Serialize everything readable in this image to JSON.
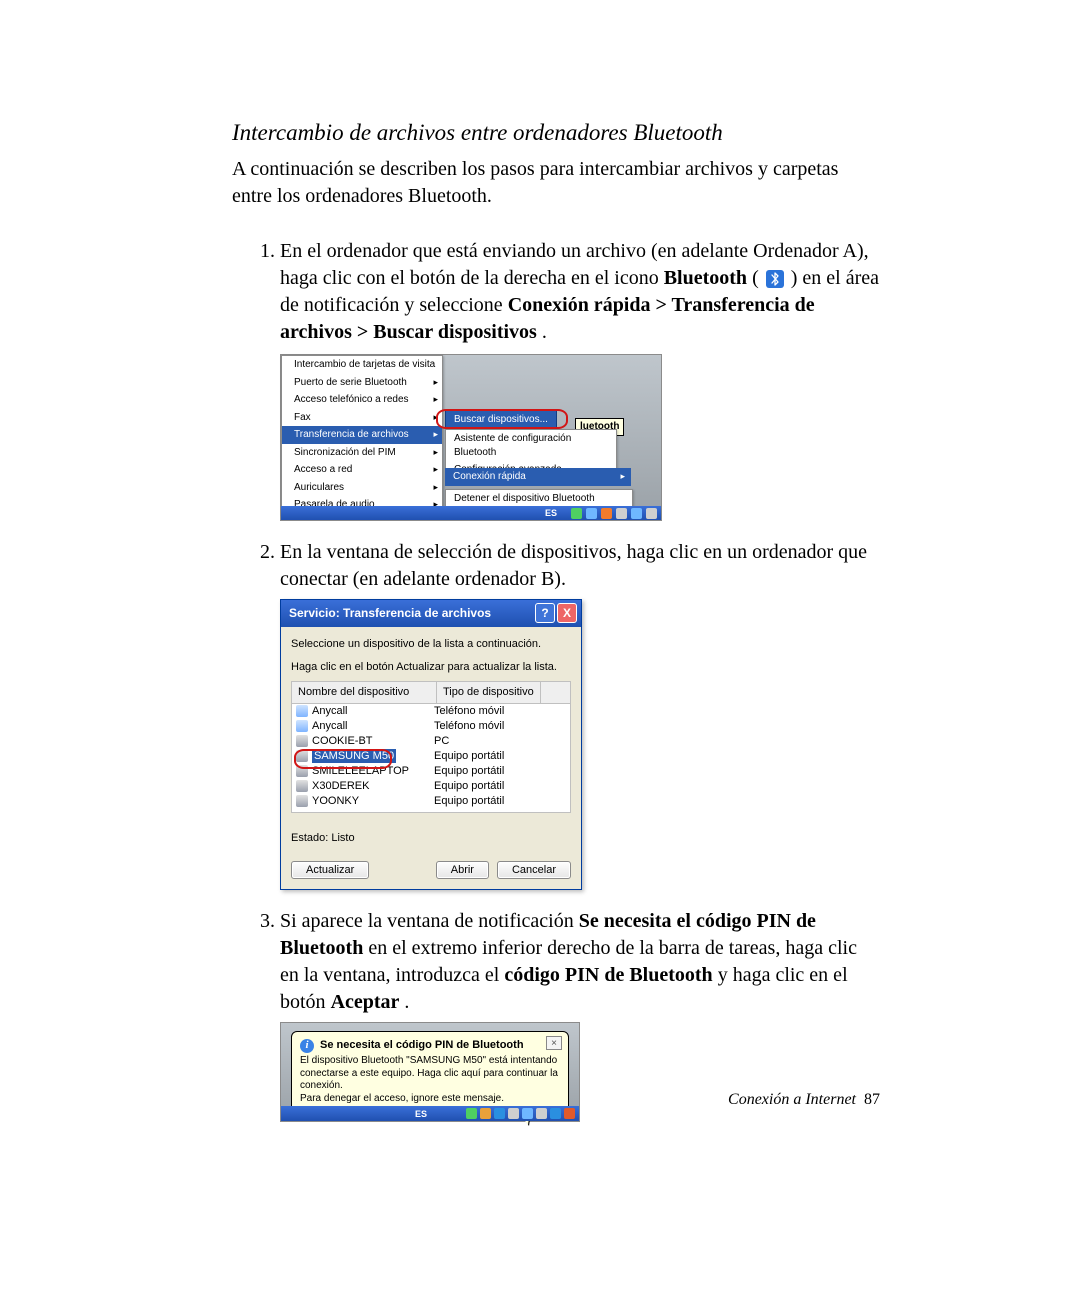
{
  "section_title": "Intercambio de archivos entre ordenadores Bluetooth",
  "intro": "A continuación se describen los pasos para intercambiar archivos y carpetas entre los ordenadores Bluetooth.",
  "step1": {
    "t1": "En el ordenador que está enviando un archivo (en adelante Ordenador A), haga clic con el botón de la derecha  en el icono ",
    "bt_word": "Bluetooth",
    "t2": " ( ",
    "t3": " ) en el área de notificación y seleccione ",
    "path_bold": "Conexión rápida > Transferencia de archivos > Buscar dispositivos",
    "t4": "."
  },
  "menu": {
    "items": [
      {
        "label": "Intercambio de tarjetas de visita",
        "arrow": false,
        "selected": false
      },
      {
        "label": "Puerto de serie Bluetooth",
        "arrow": true,
        "selected": false
      },
      {
        "label": "Acceso telefónico a redes",
        "arrow": true,
        "selected": false
      },
      {
        "label": "Fax",
        "arrow": true,
        "selected": false
      },
      {
        "label": "Transferencia de archivos",
        "arrow": true,
        "selected": true
      },
      {
        "label": "Sincronización del PIM",
        "arrow": true,
        "selected": false
      },
      {
        "label": "Acceso a red",
        "arrow": true,
        "selected": false
      },
      {
        "label": "Auriculares",
        "arrow": true,
        "selected": false
      },
      {
        "label": "Pasarela de audio",
        "arrow": true,
        "selected": false
      }
    ],
    "submenu_buscar": "Buscar dispositivos...",
    "tooltip_bt": "luetooth",
    "box_mid_1": "Asistente de configuración Bluetooth",
    "box_mid_2": "Configuración avanzada",
    "box_quick": "Conexión rápida",
    "box_stop": "Detener el dispositivo Bluetooth",
    "lang": "ES"
  },
  "step2": "En la ventana de selección de dispositivos, haga clic en un ordenador que conectar (en adelante ordenador B).",
  "dialog2": {
    "title": "Servicio: Transferencia de archivos",
    "instruct": "Seleccione un dispositivo de la lista a continuación.",
    "instruct2": "Haga clic en el botón Actualizar para actualizar la lista.",
    "col1": "Nombre del dispositivo",
    "col2": "Tipo de dispositivo",
    "rows": [
      {
        "icon": "phone",
        "name": "Anycall",
        "type": "Teléfono móvil",
        "sel": false
      },
      {
        "icon": "phone",
        "name": "Anycall",
        "type": "Teléfono móvil",
        "sel": false
      },
      {
        "icon": "pc",
        "name": "COOKIE-BT",
        "type": "PC",
        "sel": false
      },
      {
        "icon": "pc",
        "name": "SAMSUNG M50",
        "type": "Equipo portátil",
        "sel": true
      },
      {
        "icon": "pc",
        "name": "SMILELEELAPTOP",
        "type": "Equipo portátil",
        "sel": false
      },
      {
        "icon": "pc",
        "name": "X30DEREK",
        "type": "Equipo portátil",
        "sel": false
      },
      {
        "icon": "pc",
        "name": "YOONKY",
        "type": "Equipo portátil",
        "sel": false
      }
    ],
    "status": "Estado: Listo",
    "btn_refresh": "Actualizar",
    "btn_open": "Abrir",
    "btn_cancel": "Cancelar"
  },
  "step3": {
    "t1": "Si aparece la ventana de notificación ",
    "b1": "Se necesita el código PIN de Bluetooth",
    "t2": " en el extremo inferior derecho de la barra de tareas, haga clic en la ventana, introduzca el ",
    "b2": "código PIN de Bluetooth",
    "t3": " y haga clic en el botón ",
    "b3": "Aceptar",
    "t4": "."
  },
  "balloon": {
    "title": "Se necesita el código PIN de Bluetooth",
    "body1": "El dispositivo Bluetooth \"SAMSUNG M50\" está intentando conectarse a este equipo. Haga clic aquí para continuar la conexión.",
    "body2": "Para denegar el acceso, ignore este mensaje.",
    "lang": "ES"
  },
  "footer": {
    "label": "Conexión a Internet",
    "page": "87"
  }
}
